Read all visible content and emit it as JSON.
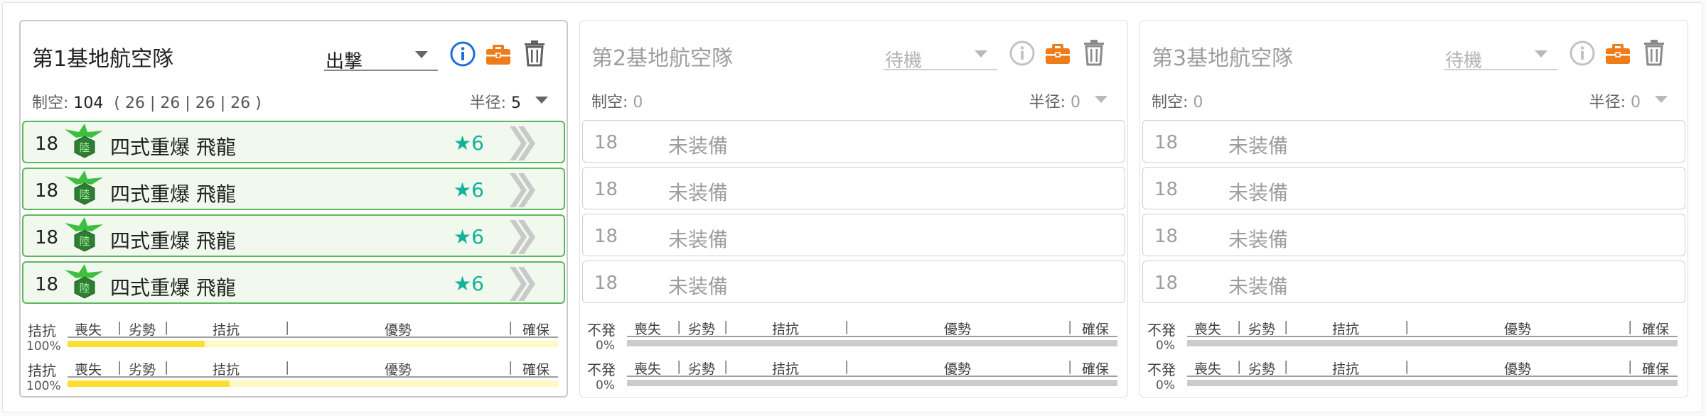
{
  "fleets": [
    {
      "title": "第1基地航空隊",
      "mode": "出撃",
      "air_power_label": "制空:",
      "air_power": "104",
      "air_power_breakdown": "( 26 | 26 | 26 | 26 )",
      "radius_label": "半径:",
      "radius": "5",
      "slots": [
        {
          "count": "18",
          "name": "四式重爆 飛龍",
          "stars": "★6"
        },
        {
          "count": "18",
          "name": "四式重爆 飛龍",
          "stars": "★6"
        },
        {
          "count": "18",
          "name": "四式重爆 飛龍",
          "stars": "★6"
        },
        {
          "count": "18",
          "name": "四式重爆 飛龍",
          "stars": "★6"
        }
      ],
      "bars": [
        {
          "status": "拮抗",
          "percent": "100%",
          "fill": 0.28
        },
        {
          "status": "拮抗",
          "percent": "100%",
          "fill": 0.33
        }
      ]
    },
    {
      "title": "第2基地航空隊",
      "mode": "待機",
      "air_power_label": "制空:",
      "air_power": "0",
      "radius_label": "半径:",
      "radius": "0",
      "slots": [
        {
          "count": "18",
          "name": "未装備"
        },
        {
          "count": "18",
          "name": "未装備"
        },
        {
          "count": "18",
          "name": "未装備"
        },
        {
          "count": "18",
          "name": "未装備"
        }
      ],
      "bars": [
        {
          "status": "不発",
          "percent": "0%",
          "fill": 0
        },
        {
          "status": "不発",
          "percent": "0%",
          "fill": 0
        }
      ]
    },
    {
      "title": "第3基地航空隊",
      "mode": "待機",
      "air_power_label": "制空:",
      "air_power": "0",
      "radius_label": "半径:",
      "radius": "0",
      "slots": [
        {
          "count": "18",
          "name": "未装備"
        },
        {
          "count": "18",
          "name": "未装備"
        },
        {
          "count": "18",
          "name": "未装備"
        },
        {
          "count": "18",
          "name": "未装備"
        }
      ],
      "bars": [
        {
          "status": "不発",
          "percent": "0%",
          "fill": 0
        },
        {
          "status": "不発",
          "percent": "0%",
          "fill": 0
        }
      ]
    }
  ],
  "bar_labels": {
    "loss": "喪失",
    "denial": "劣勢",
    "parity": "拮抗",
    "superiority": "優勢",
    "supremacy": "確保"
  },
  "colors": {
    "accent_blue": "#1e6fd9",
    "briefcase_orange": "#ef7c1a",
    "slot_green_border": "#5cb85c",
    "star_teal": "#14b29a",
    "bar_yellow": "#fde02f"
  },
  "icons": [
    "info-icon",
    "briefcase-icon",
    "trash-icon",
    "plane-icon",
    "proficiency-chevron-icon",
    "chevron-down-icon"
  ]
}
